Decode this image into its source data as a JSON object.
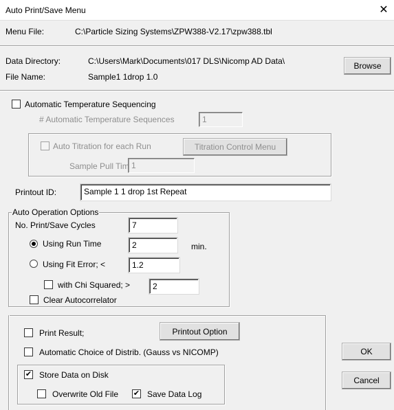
{
  "window": {
    "title": "Auto Print/Save Menu",
    "close_glyph": "✕"
  },
  "menu_file": {
    "label": "Menu File:",
    "value": "C:\\Particle Sizing Systems\\ZPW388-V2.17\\zpw388.tbl"
  },
  "data_directory": {
    "label": "Data Directory:",
    "value": "C:\\Users\\Mark\\Documents\\017 DLS\\Nicomp AD Data\\"
  },
  "file_name": {
    "label": "File Name:",
    "value": "Sample1 1drop 1.0"
  },
  "browse_button": "Browse",
  "temperature": {
    "checkbox_label": "Automatic Temperature Sequencing",
    "checked": false,
    "sequences_label": "# Automatic Temperature Sequences",
    "sequences_value": "1"
  },
  "titration": {
    "checkbox_label": "Auto Titration for each Run",
    "checked": false,
    "control_button": "Titration Control Menu",
    "pull_time_label": "Sample Pull Time",
    "pull_time_value": "1"
  },
  "printout_id": {
    "label": "Printout ID:",
    "value": "Sample 1 1 drop 1st Repeat"
  },
  "auto_operation": {
    "legend": "Auto Operation Options",
    "cycles_label": "No. Print/Save Cycles",
    "cycles_value": "7",
    "run_time_label": "Using Run Time",
    "run_time_selected": true,
    "run_time_value": "2",
    "run_time_unit": "min.",
    "fit_error_label": "Using Fit Error;  <",
    "fit_error_selected": false,
    "fit_error_value": "1.2",
    "chi_squared_label": "with Chi Squared;  >",
    "chi_squared_checked": false,
    "chi_squared_value": "2",
    "clear_autocorrelator_label": "Clear Autocorrelator",
    "clear_autocorrelator_checked": false
  },
  "output": {
    "print_result_label": "Print Result;",
    "print_result_checked": false,
    "printout_option_button": "Printout Option",
    "auto_choice_label": "Automatic Choice of Distrib. (Gauss vs NICOMP)",
    "auto_choice_checked": false,
    "store_data_label": "Store Data on Disk",
    "store_data_checked": true,
    "overwrite_label": "Overwrite Old File",
    "overwrite_checked": false,
    "save_log_label": "Save Data Log",
    "save_log_checked": true
  },
  "ok_button": "OK",
  "cancel_button": "Cancel",
  "check_glyph": "✔"
}
